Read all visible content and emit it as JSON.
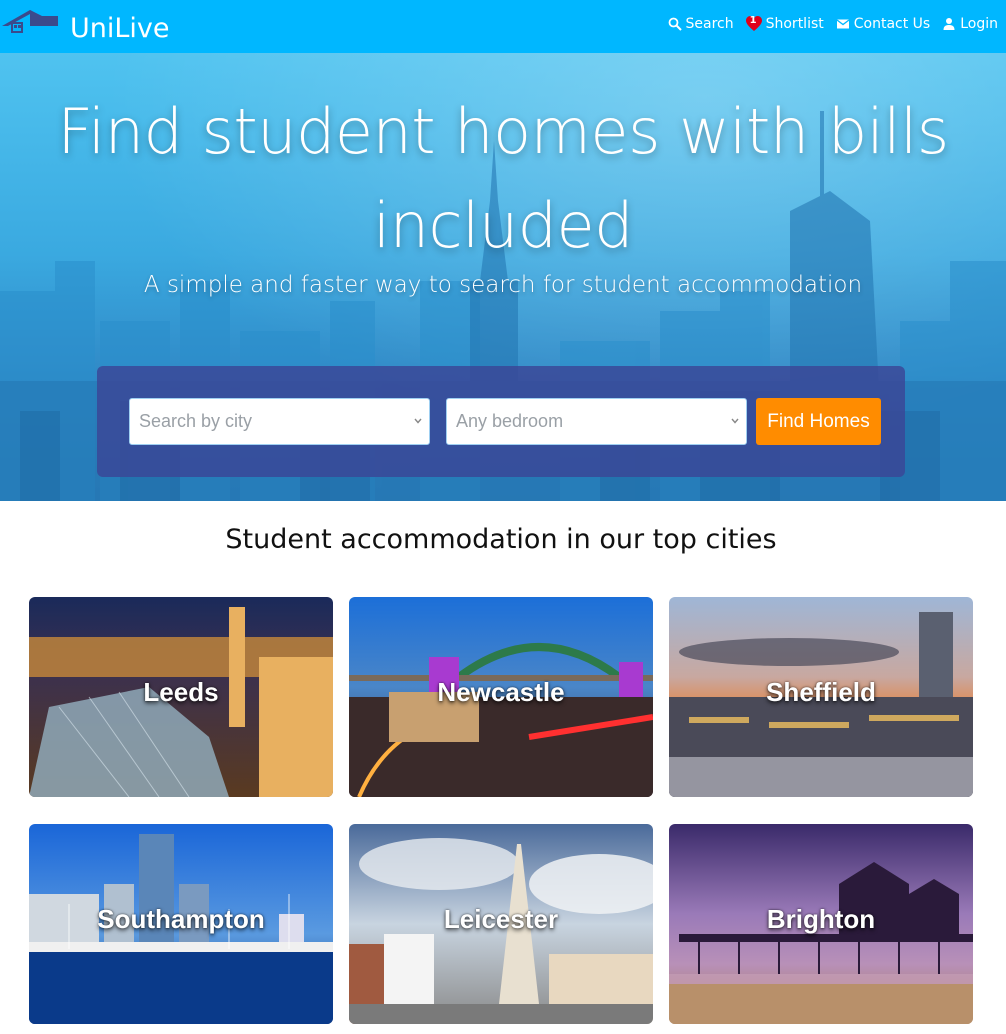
{
  "header": {
    "brand": "UniLive",
    "nav": {
      "search": "Search",
      "shortlist": "Shortlist",
      "shortlist_count": "1",
      "contact": "Contact Us",
      "login": "Login"
    }
  },
  "hero": {
    "title_line1": "Find student homes with bills",
    "title_line2": "included",
    "subtitle": "A simple and faster way to search for student accommodation"
  },
  "search": {
    "city_placeholder": "Search by city",
    "bedroom_placeholder": "Any bedroom",
    "button_label": "Find Homes"
  },
  "section": {
    "title": "Student accommodation in our top cities"
  },
  "cities": [
    {
      "name": "Leeds"
    },
    {
      "name": "Newcastle"
    },
    {
      "name": "Sheffield"
    },
    {
      "name": "Southampton"
    },
    {
      "name": "Leicester"
    },
    {
      "name": "Brighton"
    }
  ],
  "colors": {
    "header": "#00b7ff",
    "accent_button": "#ff8c00",
    "search_panel": "#3a4696"
  },
  "icons": [
    "house-logo-icon",
    "search-icon",
    "heart-icon",
    "mail-icon",
    "person-icon",
    "chevron-down-icon"
  ]
}
